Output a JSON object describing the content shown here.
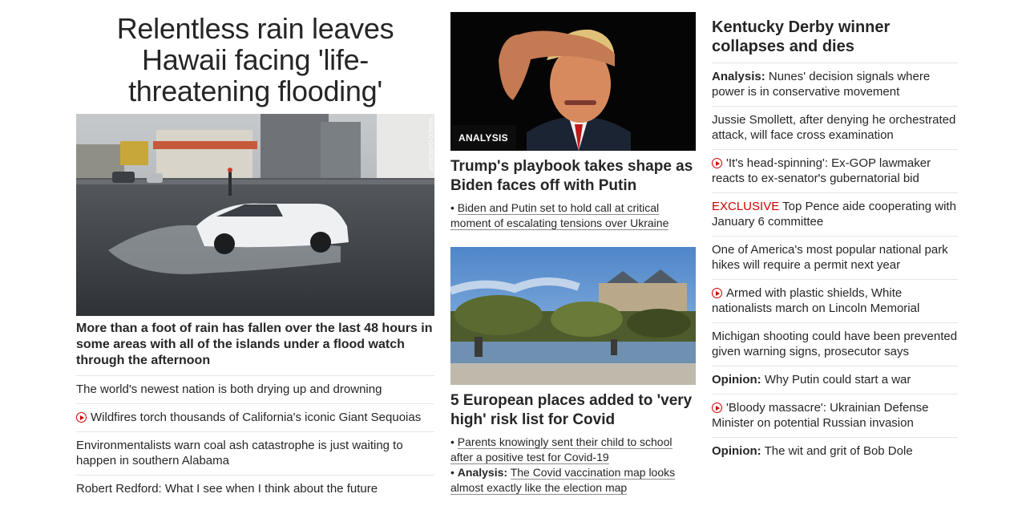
{
  "col1": {
    "headline": "Relentless rain leaves Hawaii facing 'life-threatening flooding'",
    "photo_credit": "MARCO GARCIA/AP",
    "caption": "More than a foot of rain has fallen over the last 48 hours in some areas with all of the islands under a flood watch through the afternoon",
    "links": [
      {
        "text": "The world's newest nation is both drying up and drowning"
      },
      {
        "text": "Wildfires torch thousands of California's iconic Giant Sequoias",
        "icon": "play-icon"
      },
      {
        "text": "Environmentalists warn coal ash catastrophe is just waiting to happen in southern Alabama"
      },
      {
        "text": "Robert Redford: What I see when I think about the future"
      }
    ]
  },
  "col2": {
    "card1": {
      "tag": "ANALYSIS",
      "title": "Trump's playbook takes shape as Biden faces off with Putin",
      "sub": "Biden and Putin set to hold call at critical moment of escalating tensions over Ukraine"
    },
    "card2": {
      "title": "5 European places added to 'very high' risk list for Covid",
      "sub1": "Parents knowingly sent their child to school after a positive test for Covid-19",
      "sub2_prefix": "Analysis:",
      "sub2": "The Covid vaccination map looks almost exactly like the election map"
    }
  },
  "col3": {
    "title": "Kentucky Derby winner collapses and dies",
    "items": [
      {
        "prefix": "Analysis:",
        "text": "Nunes' decision signals where power is in conservative movement"
      },
      {
        "text": "Jussie Smollett, after denying he orchestrated attack, will face cross examination"
      },
      {
        "text": "'It's head-spinning': Ex-GOP lawmaker reacts to ex-senator's gubernatorial bid",
        "icon": "play-icon"
      },
      {
        "red_prefix": "EXCLUSIVE",
        "text": "Top Pence aide cooperating with January 6 committee"
      },
      {
        "text": "One of America's most popular national park hikes will require a permit next year"
      },
      {
        "text": "Armed with plastic shields, White nationalists march on Lincoln Memorial",
        "icon": "play-icon"
      },
      {
        "text": "Michigan shooting could have been prevented given warning signs, prosecutor says"
      },
      {
        "prefix": "Opinion:",
        "text": "Why Putin could start a war"
      },
      {
        "text": "'Bloody massacre': Ukrainian Defense Minister on potential Russian invasion",
        "icon": "play-icon"
      },
      {
        "prefix": "Opinion:",
        "text": "The wit and grit of Bob Dole"
      }
    ]
  },
  "colors": {
    "accent": "#cc0000",
    "text": "#262626",
    "divider": "#e6e6e6"
  }
}
